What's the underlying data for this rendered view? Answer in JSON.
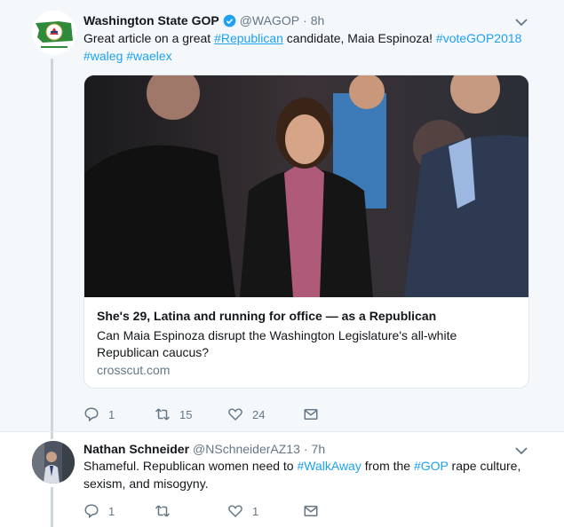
{
  "tweet1": {
    "name": "Washington State GOP",
    "handle": "@WAGOP",
    "time": "8h",
    "text_parts": [
      {
        "t": "Great article on a great ",
        "k": "plain"
      },
      {
        "t": "#Republican",
        "k": "tag-u"
      },
      {
        "t": " candidate, Maia Espinoza! ",
        "k": "plain"
      },
      {
        "t": "#voteGOP2018",
        "k": "tag"
      },
      {
        "t": " ",
        "k": "plain"
      },
      {
        "t": "#waleg",
        "k": "tag"
      },
      {
        "t": " ",
        "k": "plain"
      },
      {
        "t": "#waelex",
        "k": "tag"
      }
    ],
    "card": {
      "title": "She's 29, Latina and running for office — as a Republican",
      "description": "Can Maia Espinoza disrupt the Washington Legislature's all-white Republican caucus?",
      "domain": "crosscut.com"
    },
    "actions": {
      "replies": "1",
      "retweets": "15",
      "likes": "24"
    }
  },
  "tweet2": {
    "name": "Nathan Schneider",
    "handle": "@NSchneiderAZ13",
    "time": "7h",
    "text_parts": [
      {
        "t": "Shameful.  Republican women need to ",
        "k": "plain"
      },
      {
        "t": "#WalkAway",
        "k": "tag"
      },
      {
        "t": " from the ",
        "k": "plain"
      },
      {
        "t": "#GOP",
        "k": "tag"
      },
      {
        "t": " rape culture, sexism, and misogyny.",
        "k": "plain"
      }
    ],
    "actions": {
      "replies": "1",
      "retweets": "",
      "likes": "1"
    }
  },
  "colors": {
    "accent": "#1da1f2",
    "muted": "#657786",
    "verified": "#1da1f2"
  }
}
